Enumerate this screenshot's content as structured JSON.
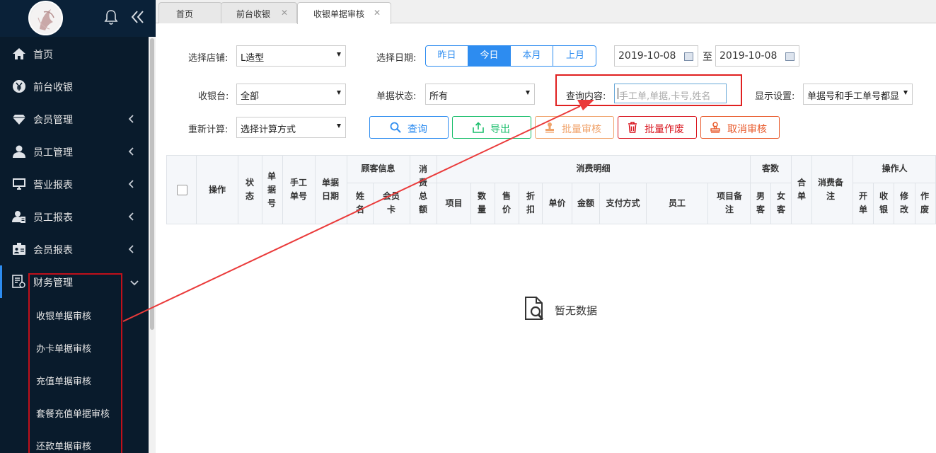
{
  "sidebar": {
    "menu": [
      {
        "label": "首页",
        "icon": "home-icon"
      },
      {
        "label": "前台收银",
        "icon": "yen-icon"
      },
      {
        "label": "会员管理",
        "icon": "diamond-icon"
      },
      {
        "label": "员工管理",
        "icon": "user-icon"
      },
      {
        "label": "营业报表",
        "icon": "monitor-icon"
      },
      {
        "label": "员工报表",
        "icon": "user-report-icon"
      },
      {
        "label": "会员报表",
        "icon": "id-card-icon"
      },
      {
        "label": "财务管理",
        "icon": "finance-icon"
      }
    ],
    "submenu": [
      "收银单据审核",
      "办卡单据审核",
      "充值单据审核",
      "套餐充值单据审核",
      "还款单据审核"
    ]
  },
  "tabs": [
    {
      "label": "首页"
    },
    {
      "label": "前台收银"
    },
    {
      "label": "收银单据审核"
    }
  ],
  "filters": {
    "store_label": "选择店铺:",
    "store_value": "L造型",
    "date_label": "选择日期:",
    "date_options": [
      "昨日",
      "今日",
      "本月",
      "上月"
    ],
    "date_selected": "今日",
    "date_from": "2019-10-08",
    "date_to_label": "至",
    "date_to": "2019-10-08",
    "cashier_label": "收银台:",
    "cashier_value": "全部",
    "status_label": "单据状态:",
    "status_value": "所有",
    "query_label": "查询内容:",
    "query_placeholder": "手工单,单据,卡号,姓名",
    "display_label": "显示设置:",
    "display_value": "单据号和手工单号都显示",
    "recalc_label": "重新计算:",
    "recalc_value": "选择计算方式"
  },
  "buttons": {
    "search": "查询",
    "export": "导出",
    "batch_audit": "批量审核",
    "batch_void": "批量作废",
    "cancel_audit": "取消审核"
  },
  "table": {
    "headers": {
      "op": "操作",
      "status": "状态",
      "bill_no": "单据号",
      "manual_no": "手工单号",
      "bill_date": "单据日期",
      "customer_info": "顾客信息",
      "name": "姓名",
      "member_card": "会员卡",
      "total": "消费总额",
      "detail": "消费明细",
      "item": "项目",
      "qty": "数量",
      "price": "售价",
      "discount": "折扣",
      "unit_price": "单价",
      "amount": "金额",
      "pay_method": "支付方式",
      "staff": "员工",
      "item_note": "项目备注",
      "guests": "客数",
      "male": "男客",
      "female": "女客",
      "merge": "合单",
      "note": "消费备注",
      "operator": "操作人",
      "open": "开单",
      "cashier": "收银",
      "modify": "修改",
      "void": "作废"
    },
    "empty_text": "暂无数据"
  },
  "colors": {
    "accent": "#2d8cf0",
    "sidebar_bg": "#091b2c",
    "highlight": "#e02020"
  }
}
